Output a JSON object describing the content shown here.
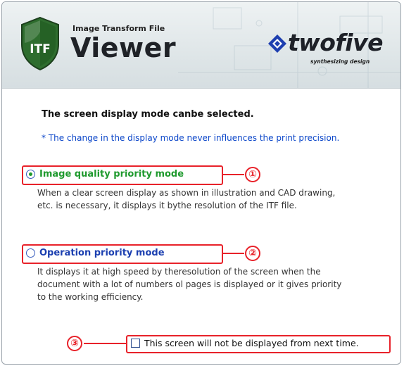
{
  "banner": {
    "app_subtitle": "Image Transform File",
    "app_name": "Viewer",
    "shield_text": "ITF",
    "brand_name": "twofive",
    "brand_tagline": "synthesizing design"
  },
  "content": {
    "heading": "The screen display mode canbe selected.",
    "note": "* The change in the display mode never influences the print precision."
  },
  "options": [
    {
      "label": "Image quality priority mode",
      "selected": true,
      "description_lines": [
        "When a clear screen display as shown in illustration and CAD drawing,",
        "etc. is necessary, it displays it bythe resolution of the ITF file."
      ],
      "callout": "①"
    },
    {
      "label": "Operation priority mode",
      "selected": false,
      "description_lines": [
        "It displays it at high speed by theresolution of the screen when the",
        "document with a lot of numbers ol pages is displayed or it gives priority",
        "to the working efficiency."
      ],
      "callout": "②"
    }
  ],
  "checkbox": {
    "label": "This screen will not be displayed from next time.",
    "checked": false,
    "callout": "③"
  },
  "colors": {
    "accent_red": "#e8222a",
    "option_green": "#1f9a2e",
    "option_blue": "#1b3fb0",
    "note_blue": "#0b46c9"
  }
}
